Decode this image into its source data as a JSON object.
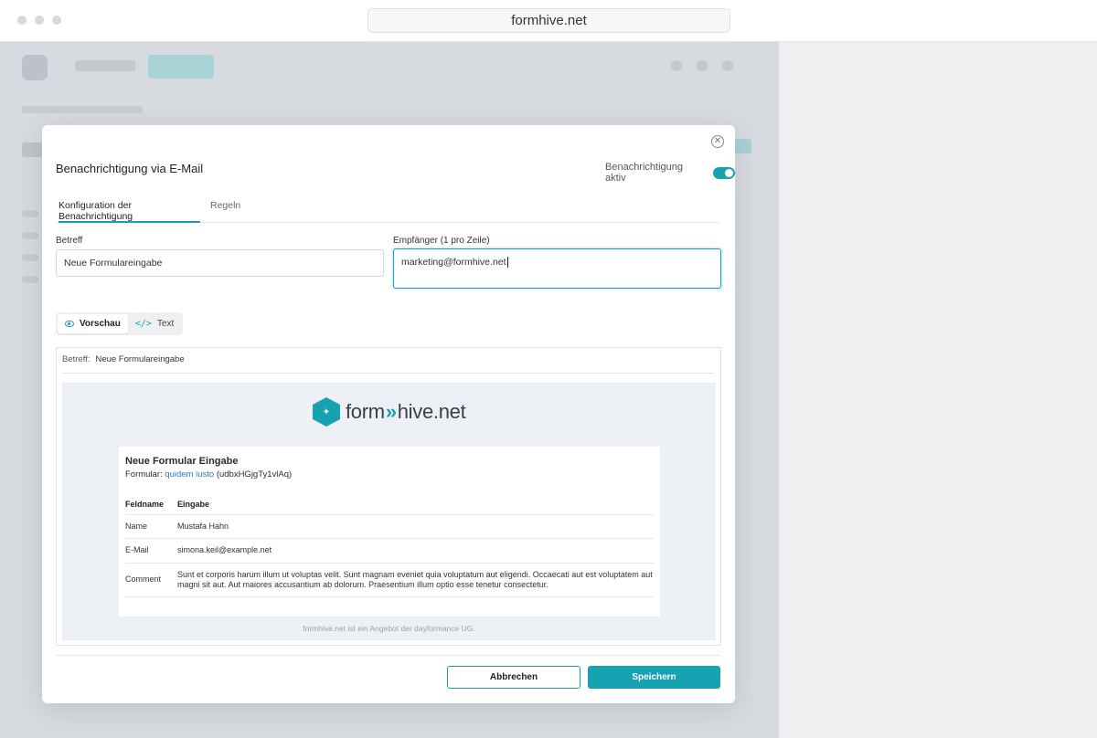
{
  "browser": {
    "url": "formhive.net"
  },
  "modal": {
    "title": "Benachrichtigung via E-Mail",
    "toggle_label": "Benachrichtigung aktiv",
    "toggle_on": true,
    "tabs": [
      {
        "label": "Konfiguration der Benachrichtigung",
        "active": true
      },
      {
        "label": "Regeln",
        "active": false
      }
    ],
    "subject_label": "Betreff",
    "subject_value": "Neue Formulareingabe",
    "recipients_label": "Empfänger (1 pro Zeile)",
    "recipients_value": "marketing@formhive.net",
    "view_modes": [
      {
        "label": "Vorschau",
        "icon": "eye-icon",
        "active": true
      },
      {
        "label": "Text",
        "icon": "code-icon",
        "active": false
      }
    ],
    "preview": {
      "subject_key": "Betreff:",
      "subject_value": "Neue Formulareingabe",
      "brand": {
        "left": "form",
        "arrows": "»",
        "right": "hive.net"
      },
      "email_title": "Neue Formular Eingabe",
      "form_prefix": "Formular:",
      "form_link": "quidem iusto",
      "form_id": "(udbxHGjgTy1vlAq)",
      "table_headers": [
        "Feldname",
        "Eingabe"
      ],
      "rows": [
        {
          "field": "Name",
          "value": "Mustafa Hahn"
        },
        {
          "field": "E-Mail",
          "value": "simona.keil@example.net"
        },
        {
          "field": "Comment",
          "value": "Sunt et corporis harum illum ut voluptas velit. Sunt magnam eveniet quia voluptatum aut eligendi. Occaecati aut est voluptatem aut magni sit aut. Aut maiores accusantium ab dolorum. Praesentium illum optio esse tenetur consectetur."
        }
      ],
      "footer": "formhive.net ist ein Angebot der dayformance UG."
    },
    "cancel_label": "Abbrechen",
    "save_label": "Speichern"
  },
  "colors": {
    "accent": "#17a2b1",
    "link": "#2a7bd6"
  }
}
